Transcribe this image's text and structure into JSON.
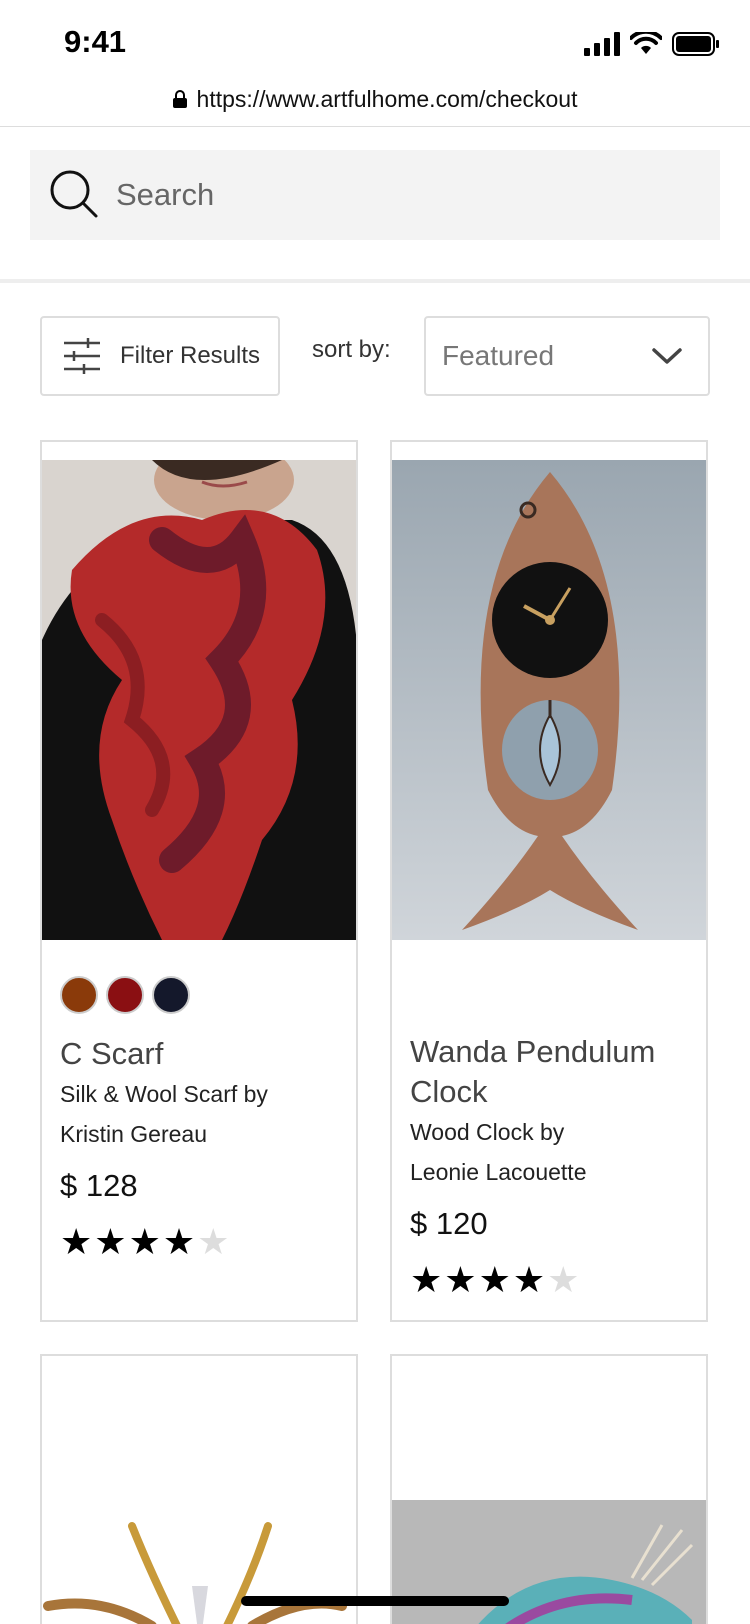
{
  "status_bar": {
    "time": "9:41"
  },
  "browser": {
    "url": "https://www.artfulhome.com/checkout"
  },
  "search": {
    "placeholder": "Search"
  },
  "filters": {
    "filter_label": "Filter Results",
    "sort_label": "sort by:",
    "sort_value": "Featured"
  },
  "products": [
    {
      "name": "C Scarf",
      "line1": "Silk & Wool Scarf by",
      "line2": "Kristin Gereau",
      "price": "$ 128",
      "rating": 4,
      "rating_max": 5,
      "swatches": [
        "#8a3a0a",
        "#8a0f12",
        "#14182b"
      ],
      "image_icon": "scarf-photo"
    },
    {
      "name_line1": "Wanda Pendulum",
      "name_line2": "Clock",
      "line1": "Wood Clock by",
      "line2": "Leonie Lacouette",
      "price": "$ 120",
      "rating": 4,
      "rating_max": 5,
      "image_icon": "fish-clock-photo"
    },
    {
      "image_icon": "glass-sculpture-photo"
    },
    {
      "image_icon": "fish-sculpture-photo"
    }
  ],
  "colors": {
    "accent_text": "#333333",
    "border": "#dddddd",
    "search_bg": "#f3f3f3"
  }
}
